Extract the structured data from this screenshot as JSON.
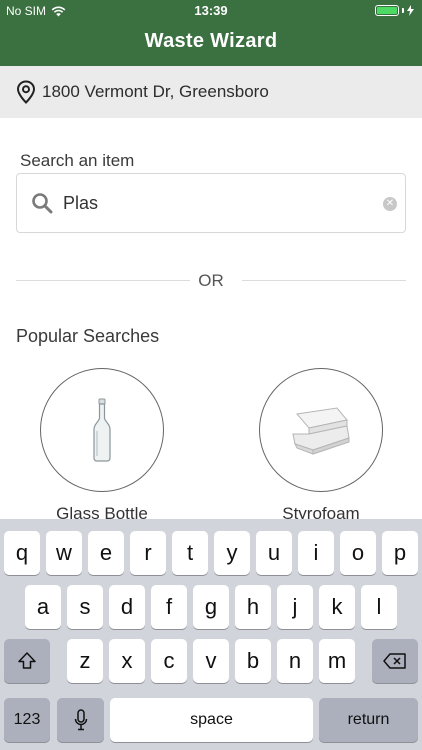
{
  "status_bar": {
    "carrier": "No SIM",
    "time": "13:39"
  },
  "header": {
    "title": "Waste Wizard"
  },
  "location": {
    "address": "1800 Vermont Dr, Greensboro"
  },
  "search": {
    "label": "Search an item",
    "value": "Plas"
  },
  "divider": {
    "text": "OR"
  },
  "popular": {
    "title": "Popular Searches",
    "items": [
      {
        "label": "Glass Bottle"
      },
      {
        "label": "Styrofoam"
      }
    ]
  },
  "keyboard": {
    "row1": [
      "q",
      "w",
      "e",
      "r",
      "t",
      "y",
      "u",
      "i",
      "o",
      "p"
    ],
    "row2": [
      "a",
      "s",
      "d",
      "f",
      "g",
      "h",
      "j",
      "k",
      "l"
    ],
    "row3": [
      "z",
      "x",
      "c",
      "v",
      "b",
      "n",
      "m"
    ],
    "numbers_label": "123",
    "space_label": "space",
    "return_label": "return"
  },
  "colors": {
    "header": "#3b7040",
    "battery": "#4cd964",
    "keyboard": "#d1d4db"
  }
}
